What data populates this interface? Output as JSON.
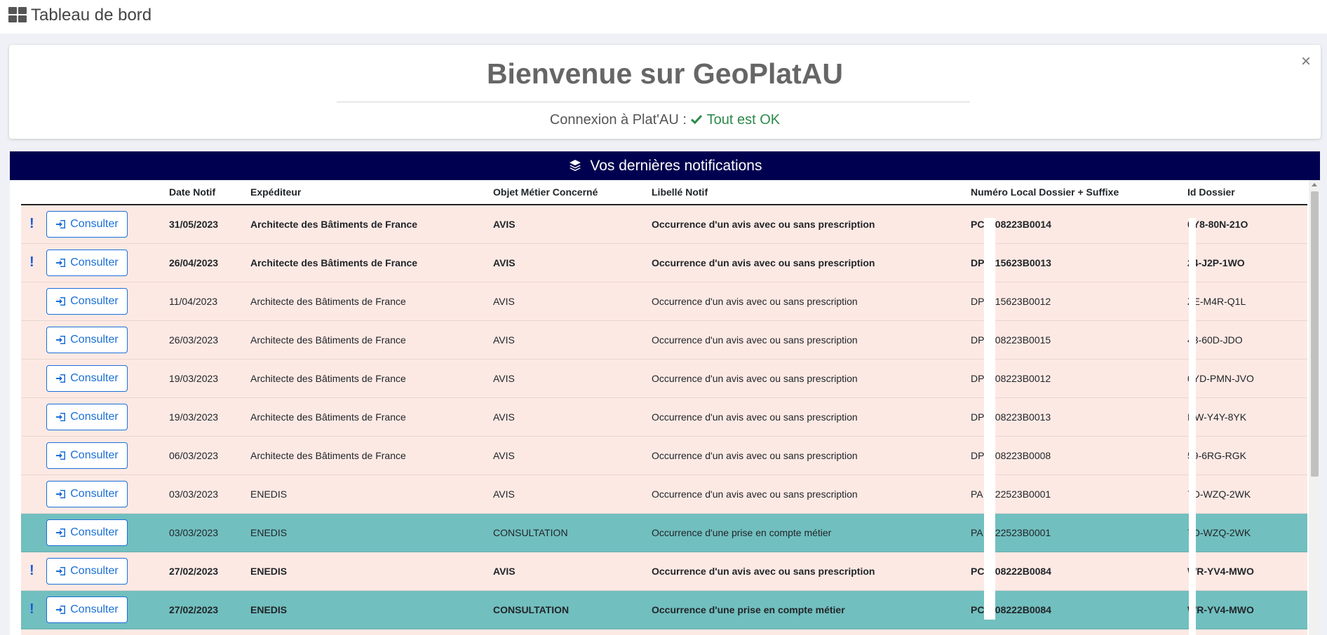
{
  "topbar": {
    "title": "Tableau de bord",
    "icon": "grid-dashboard-icon"
  },
  "welcome": {
    "title": "Bienvenue sur GeoPlatAU",
    "status_label": "Connexion à Plat'AU :",
    "status_value": "Tout est OK",
    "close": "×"
  },
  "notifications": {
    "title": "Vos dernières notifications",
    "columns": [
      "Date Notif",
      "Expéditeur",
      "Objet Métier Concerné",
      "Libellé Notif",
      "Numéro Local Dossier + Suffixe",
      "Id Dossier"
    ],
    "button_label": "Consulter",
    "unread_mark": "!",
    "rows": [
      {
        "unread": true,
        "type": "avis",
        "date": "31/05/2023",
        "sender": "Architecte des Bâtiments de France",
        "object": "AVIS",
        "label": "Occurrence d'un avis avec ou sans prescription",
        "num_a": "PC",
        "num_b": "808223B0014",
        "id": "0Y8-80N-21O"
      },
      {
        "unread": true,
        "type": "avis",
        "date": "26/04/2023",
        "sender": "Architecte des Bâtiments de France",
        "object": "AVIS",
        "label": "Occurrence d'un avis avec ou sans prescription",
        "num_a": "DP",
        "num_b": "815623B0013",
        "id": "24-J2P-1WO"
      },
      {
        "unread": false,
        "type": "avis",
        "date": "11/04/2023",
        "sender": "Architecte des Bâtiments de France",
        "object": "AVIS",
        "label": "Occurrence d'un avis avec ou sans prescription",
        "num_a": "DP",
        "num_b": "815623B0012",
        "id": "ZE-M4R-Q1L"
      },
      {
        "unread": false,
        "type": "avis",
        "date": "26/03/2023",
        "sender": "Architecte des Bâtiments de France",
        "object": "AVIS",
        "label": "Occurrence d'un avis avec ou sans prescription",
        "num_a": "DP",
        "num_b": "808223B0015",
        "id": "43-60D-JDO"
      },
      {
        "unread": false,
        "type": "avis",
        "date": "19/03/2023",
        "sender": "Architecte des Bâtiments de France",
        "object": "AVIS",
        "label": "Occurrence d'un avis avec ou sans prescription",
        "num_a": "DP",
        "num_b": "808223B0012",
        "id": "0YD-PMN-JVO"
      },
      {
        "unread": false,
        "type": "avis",
        "date": "19/03/2023",
        "sender": "Architecte des Bâtiments de France",
        "object": "AVIS",
        "label": "Occurrence d'un avis avec ou sans prescription",
        "num_a": "DP",
        "num_b": "808223B0013",
        "id": "NW-Y4Y-8YK"
      },
      {
        "unread": false,
        "type": "avis",
        "date": "06/03/2023",
        "sender": "Architecte des Bâtiments de France",
        "object": "AVIS",
        "label": "Occurrence d'un avis avec ou sans prescription",
        "num_a": "DP",
        "num_b": "808223B0008",
        "id": "59-6RG-RGK"
      },
      {
        "unread": false,
        "type": "avis",
        "date": "03/03/2023",
        "sender": "ENEDIS",
        "object": "AVIS",
        "label": "Occurrence d'un avis avec ou sans prescription",
        "num_a": "PA",
        "num_b": "822523B0001",
        "id": "7D-WZQ-2WK"
      },
      {
        "unread": false,
        "type": "consult",
        "date": "03/03/2023",
        "sender": "ENEDIS",
        "object": "CONSULTATION",
        "label": "Occurrence d'une prise en compte métier",
        "num_a": "PA",
        "num_b": "822523B0001",
        "id": "7D-WZQ-2WK"
      },
      {
        "unread": true,
        "type": "avis",
        "date": "27/02/2023",
        "sender": "ENEDIS",
        "object": "AVIS",
        "label": "Occurrence d'un avis avec ou sans prescription",
        "num_a": "PC",
        "num_b": "808222B0084",
        "id": "WR-YV4-MWO"
      },
      {
        "unread": true,
        "type": "consult",
        "date": "27/02/2023",
        "sender": "ENEDIS",
        "object": "CONSULTATION",
        "label": "Occurrence d'une prise en compte métier",
        "num_a": "PC",
        "num_b": "808222B0084",
        "id": "WR-YV4-MWO"
      }
    ]
  },
  "colors": {
    "header_bg": "#000050",
    "avis_row": "#fde9e4",
    "consultation_row": "#72bfbf",
    "accent": "#1a6fd8",
    "ok": "#2c8a4b"
  }
}
